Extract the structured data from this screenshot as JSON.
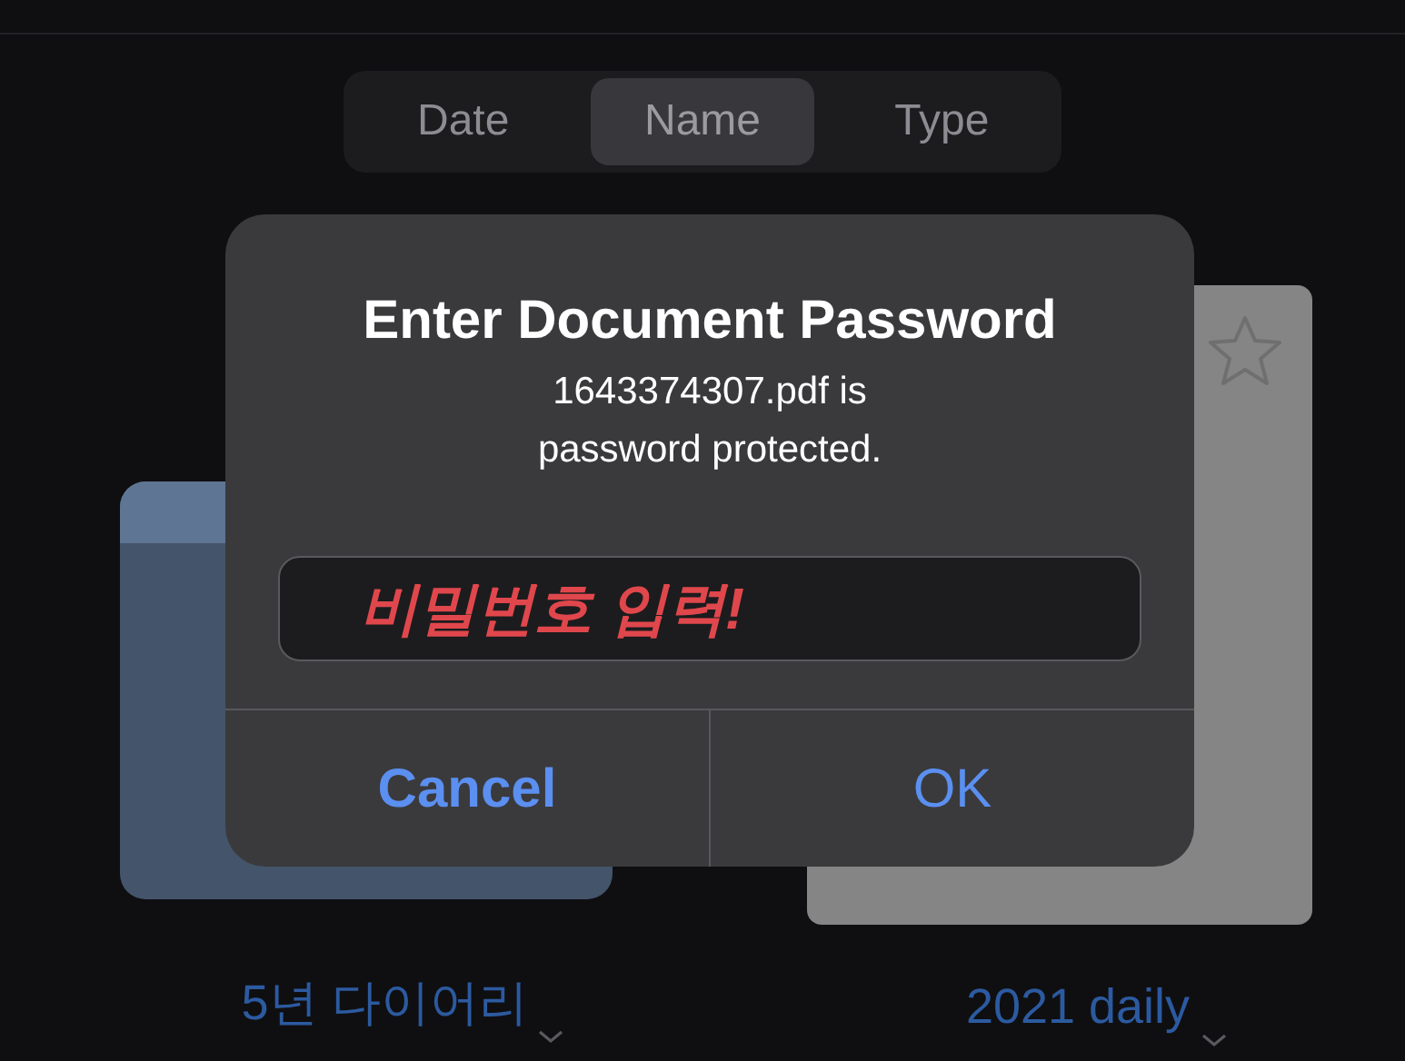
{
  "sort_tabs": [
    {
      "label": "Date",
      "selected": false
    },
    {
      "label": "Name",
      "selected": true
    },
    {
      "label": "Type",
      "selected": false
    }
  ],
  "items": [
    {
      "kind": "folder",
      "name": "5년 다이어리"
    },
    {
      "kind": "document",
      "name": "2021 daily"
    }
  ],
  "dialog": {
    "title": "Enter Document Password",
    "message_lines": [
      "1643374307.pdf is",
      "password protected."
    ],
    "password_field": {
      "annotation": "비밀번호 입력!"
    },
    "buttons": [
      {
        "label": "Cancel",
        "kind": "cancel"
      },
      {
        "label": "OK",
        "kind": "default"
      }
    ]
  }
}
